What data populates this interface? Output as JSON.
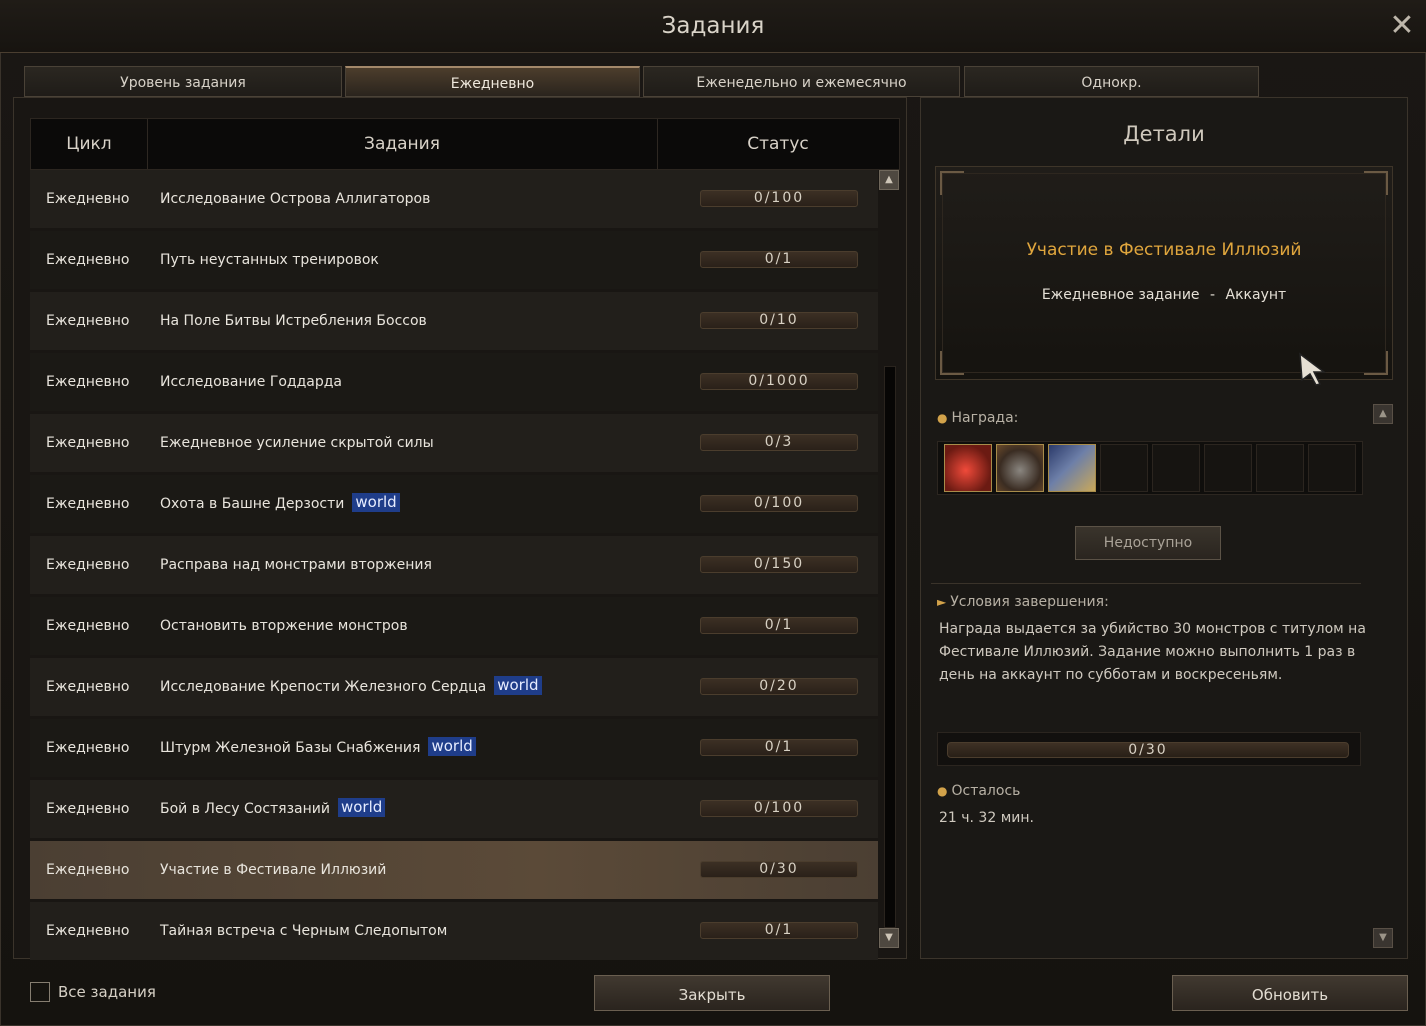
{
  "window": {
    "title": "Задания",
    "close_symbol": "✕"
  },
  "tabs": [
    {
      "label": "Уровень задания",
      "active": false
    },
    {
      "label": "Ежедневно",
      "active": true
    },
    {
      "label": "Еженедельно и ежемесячно",
      "active": false
    },
    {
      "label": "Однокр.",
      "active": false
    }
  ],
  "list": {
    "headers": {
      "cycle": "Цикл",
      "quests": "Задания",
      "status": "Статус"
    },
    "rows": [
      {
        "cycle": "Ежедневно",
        "name": "Исследование Острова Аллигаторов",
        "tag": "",
        "status": "0/100"
      },
      {
        "cycle": "Ежедневно",
        "name": "Путь неустанных тренировок",
        "tag": "",
        "status": "0/1"
      },
      {
        "cycle": "Ежедневно",
        "name": "На Поле Битвы Истребления Боссов",
        "tag": "",
        "status": "0/10"
      },
      {
        "cycle": "Ежедневно",
        "name": "Исследование Годдарда",
        "tag": "",
        "status": "0/1000"
      },
      {
        "cycle": "Ежедневно",
        "name": "Ежедневное усиление скрытой силы",
        "tag": "",
        "status": "0/3"
      },
      {
        "cycle": "Ежедневно",
        "name": "Охота в Башне Дерзости",
        "tag": "world",
        "status": "0/100"
      },
      {
        "cycle": "Ежедневно",
        "name": "Расправа над монстрами вторжения",
        "tag": "",
        "status": "0/150"
      },
      {
        "cycle": "Ежедневно",
        "name": "Остановить вторжение монстров",
        "tag": "",
        "status": "0/1"
      },
      {
        "cycle": "Ежедневно",
        "name": "Исследование Крепости Железного Сердца",
        "tag": "world",
        "status": "0/20"
      },
      {
        "cycle": "Ежедневно",
        "name": "Штурм Железной Базы Снабжения",
        "tag": "world",
        "status": "0/1"
      },
      {
        "cycle": "Ежедневно",
        "name": "Бой в Лесу Состязаний",
        "tag": "world",
        "status": "0/100"
      },
      {
        "cycle": "Ежедневно",
        "name": "Участие в Фестивале Иллюзий",
        "tag": "",
        "status": "0/30",
        "selected": true
      },
      {
        "cycle": "Ежедневно",
        "name": "Тайная встреча с Черным Следопытом",
        "tag": "",
        "status": "0/1"
      }
    ]
  },
  "details": {
    "title": "Детали",
    "quest_name": "Участие в Фестивале Иллюзий",
    "quest_type": "Ежедневное задание",
    "separator": "-",
    "quest_scope": "Аккаунт",
    "reward_label": "Награда:",
    "unavailable_button": "Недоступно",
    "conditions_label": "Условия завершения:",
    "conditions_text": "Награда выдается за убийство 30 монстров с титулом на Фестивале Иллюзий. Задание можно выполнить 1 раз в день на аккаунт по субботам и воскресеньям.",
    "progress": "0/30",
    "remaining_label": "Осталось",
    "remaining_value": "21 ч. 32 мин."
  },
  "footer": {
    "all_quests_label": "Все задания",
    "close_button": "Закрыть",
    "refresh_button": "Обновить"
  },
  "colors": {
    "accent_gold": "#e0a63d",
    "world_tag": "#1f3d8a",
    "selected_row": "#5b4a38"
  },
  "icons": {
    "scroll_up": "▲",
    "scroll_down": "▼"
  }
}
